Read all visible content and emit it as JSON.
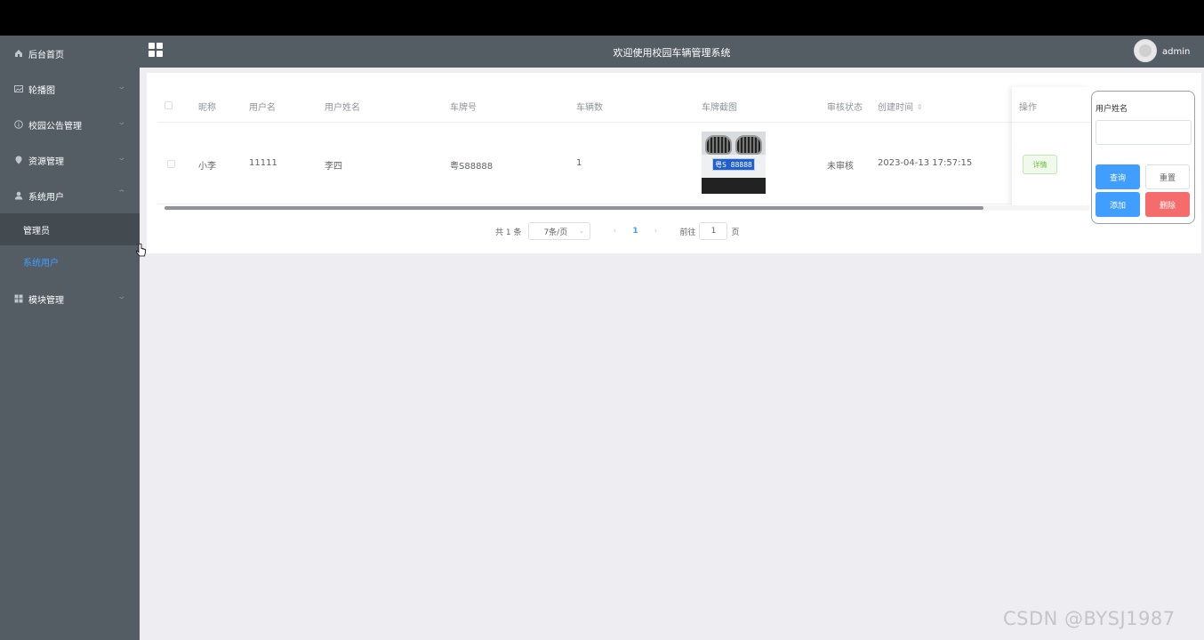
{
  "header": {
    "title": "欢迎使用校园车辆管理系统",
    "username": "admin"
  },
  "sidebar": {
    "items": [
      {
        "label": "后台首页",
        "icon": "home-icon"
      },
      {
        "label": "轮播图",
        "icon": "picture-icon"
      },
      {
        "label": "校园公告管理",
        "icon": "info-icon"
      },
      {
        "label": "资源管理",
        "icon": "location-icon"
      },
      {
        "label": "系统用户",
        "icon": "user-icon"
      },
      {
        "label": "模块管理",
        "icon": "grid-icon"
      }
    ],
    "sub_items": [
      {
        "label": "管理员"
      },
      {
        "label": "系统用户"
      }
    ]
  },
  "table": {
    "columns": [
      "昵称",
      "用户名",
      "用户姓名",
      "车牌号",
      "车辆数",
      "车牌截图",
      "审核状态",
      "创建时间",
      "操作"
    ],
    "rows": [
      {
        "nickname": "小李",
        "username": "11111",
        "real_name": "李四",
        "plate_number": "粤S88888",
        "vehicle_count": "1",
        "plate_image_text": "粤S 88888",
        "review_status": "未审核",
        "created_at": "2023-04-13 17:57:15",
        "action_label": "详情"
      }
    ]
  },
  "pagination": {
    "total": "共 1 条",
    "page_size": "7条/页",
    "current_page": "1",
    "goto_label": "前往",
    "goto_value": "1",
    "page_suffix": "页"
  },
  "search": {
    "label": "用户姓名",
    "value": "",
    "query_label": "查询",
    "reset_label": "重置",
    "add_label": "添加",
    "delete_label": "删除"
  },
  "watermark": "CSDN @BYSJ1987",
  "colors": {
    "sidebar_bg": "#545c64",
    "primary": "#409eff",
    "danger": "#f56c6c",
    "success": "#67c23a",
    "page_bg": "#eeeef2"
  }
}
